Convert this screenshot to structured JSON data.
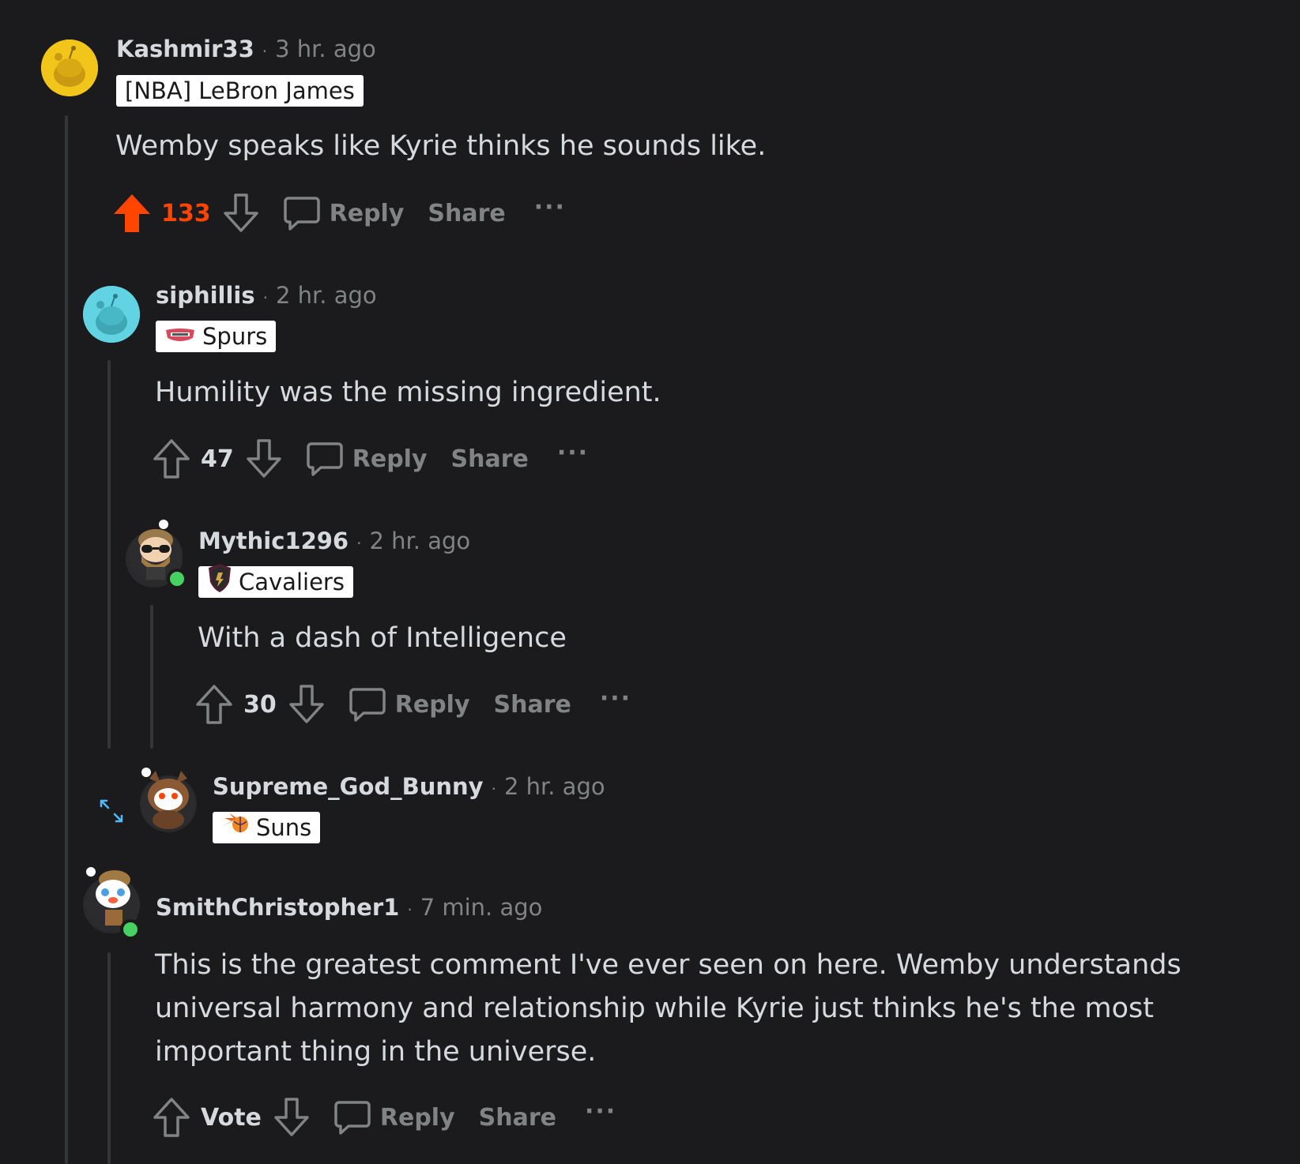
{
  "colors": {
    "background": "#1b1b1d",
    "upvote_active": "#ff4500",
    "muted": "#818384",
    "text": "#d7dadc",
    "online": "#46d160"
  },
  "comments": [
    {
      "username": "Kashmir33",
      "time": "3 hr. ago",
      "flair": "[NBA] LeBron James",
      "flair_icon": null,
      "body": "Wemby speaks like Kyrie thinks he sounds like.",
      "votes": "133",
      "upvoted": true,
      "reply": "Reply",
      "share": "Share",
      "more": "···"
    },
    {
      "username": "siphillis",
      "time": "2 hr. ago",
      "flair": "Spurs",
      "flair_icon": "spurs-logo-icon",
      "body": "Humility was the missing ingredient.",
      "votes": "47",
      "upvoted": false,
      "reply": "Reply",
      "share": "Share",
      "more": "···"
    },
    {
      "username": "Mythic1296",
      "time": "2 hr. ago",
      "flair": "Cavaliers",
      "flair_icon": "cavaliers-logo-icon",
      "online": true,
      "body": "With a dash of Intelligence",
      "votes": "30",
      "upvoted": false,
      "reply": "Reply",
      "share": "Share",
      "more": "···"
    },
    {
      "username": "Supreme_God_Bunny",
      "time": "2 hr. ago",
      "flair": "Suns",
      "flair_icon": "suns-logo-icon",
      "collapsed": true
    },
    {
      "username": "SmithChristopher1",
      "time": "7 min. ago",
      "online": true,
      "body": "This is the greatest comment I've ever seen on here. Wemby understands universal harmony and relationship while Kyrie just thinks he's the most important thing in the universe.",
      "votes": "Vote",
      "upvoted": false,
      "reply": "Reply",
      "share": "Share",
      "more": "···"
    }
  ]
}
